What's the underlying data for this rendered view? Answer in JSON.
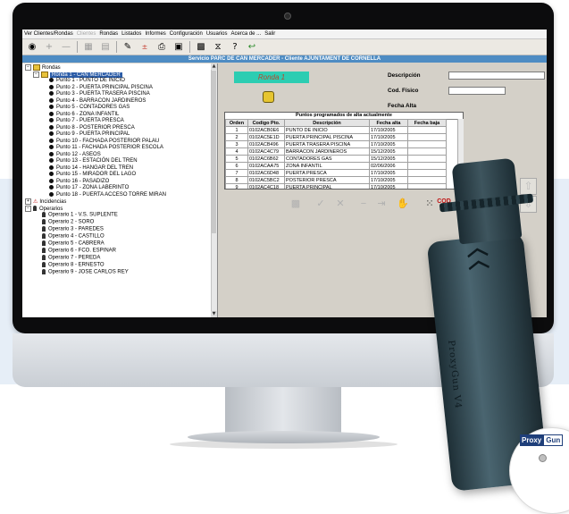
{
  "menu": [
    "Ver Clientes/Rondas",
    "Clientes",
    "Rondas",
    "Listados",
    "Informes",
    "Configuración",
    "Usuarios",
    "Acerca de ...",
    "Salir"
  ],
  "title": "Servicio PARC DE CAN MERCADER - Cliente AJUNTAMENT DE CORNELLA",
  "tree": {
    "root": "Rondas",
    "ronda": "Ronda 1 - CAN MERCADER",
    "puntos": [
      "Punto 1 - PUNTO DE INICIO",
      "Punto 2 - PUERTA PRINCIPAL PISCINA",
      "Punto 3 - PUERTA TRASERA PISCINA",
      "Punto 4 - BARRACON JARDINEROS",
      "Punto 5 - CONTADORES GAS",
      "Punto 6 - ZONA INFANTIL",
      "Punto 7 - PUERTA PRESCA",
      "Punto 8 - POSTERIOR PRESCA",
      "Punto 9 - PUERTA PRINCIPAL",
      "Punto 10 - FACHADA POSTERIOR PALAU",
      "Punto 11 - FACHADA POSTERIOR ESCOLA",
      "Punto 12 - ASEOS",
      "Punto 13 - ESTACIÓN DEL TREN",
      "Punto 14 - HANGAR DEL TREN",
      "Punto 15 - MIRADOR DEL LAGO",
      "Punto 16 - PASADIZO",
      "Punto 17 - ZONA LABERINTO",
      "Punto 18 - PUERTA ACCESO TORRE MIRAN"
    ],
    "incidencias": "Incidencias",
    "operarios_label": "Operarios",
    "operarios": [
      "Operario 1 - V.S. SUPLENTE",
      "Operario 2 - SORO",
      "Operario 3 - PAREDES",
      "Operario 4 - CASTILLO",
      "Operario 5 - CABRERA",
      "Operario 6 - FCO. ESPINAR",
      "Operario 7 - PEREDA",
      "Operario 8 - ERNESTO",
      "Operario 9 - JOSE CARLOS REY"
    ]
  },
  "panel": {
    "ronda_title": "Ronda 1",
    "descripcion_label": "Descripción",
    "codfisico_label": "Cod. Físico",
    "fecha_alta_label": "Fecha Alta"
  },
  "grid": {
    "caption": "Puntos programados de alta actualmente",
    "headers": [
      "Orden",
      "Codigo Pto.",
      "Descripción",
      "Fecha alta",
      "Fecha baja"
    ],
    "rows": [
      [
        "1",
        "0102ACB0E6",
        "PUNTO DE INICIO",
        "17/10/2005",
        ""
      ],
      [
        "2",
        "0102AC5E1D",
        "PUERTA PRINCIPAL PISCINA",
        "17/10/2005",
        ""
      ],
      [
        "3",
        "0102ACB496",
        "PUERTA TRASERA PISCINA",
        "17/10/2005",
        ""
      ],
      [
        "4",
        "0102AC4C79",
        "BARRACON JARDINEROS",
        "15/12/2005",
        ""
      ],
      [
        "5",
        "0102AC6B62",
        "CONTADORES GAS",
        "15/12/2005",
        ""
      ],
      [
        "6",
        "0102ACAA75",
        "ZONA INFANTIL",
        "02/06/2006",
        ""
      ],
      [
        "7",
        "0102AC6D48",
        "PUERTA PRESCA",
        "17/10/2005",
        ""
      ],
      [
        "8",
        "0102AC5BC2",
        "POSTERIOR PRESCA",
        "17/10/2005",
        ""
      ],
      [
        "9",
        "0102AC4C18",
        "PUERTA PRINCIPAL",
        "17/10/2005",
        ""
      ],
      [
        "10",
        "0102AC6348",
        "FACHADA POSTERIOR PALAU",
        "17/10/2005",
        ""
      ],
      [
        "11",
        "0102ACB578",
        "FACHADA POSTERIOR ESCOLA",
        "17/10/2005",
        ""
      ],
      [
        "12",
        "0102AC6E8C",
        "ASEOS",
        "17/10/2005",
        ""
      ],
      [
        "13",
        "0102AC5C7A",
        "ESTACIÓN DEL TREN",
        "17/10/2005",
        ""
      ]
    ]
  },
  "device": {
    "label": "ProxyGun V4"
  },
  "badge": {
    "brand_a": "Proxy",
    "brand_b": "Gun"
  },
  "icons": [
    "eye-icon",
    "plus-icon",
    "minus-icon",
    "grid-icon",
    "pen-icon",
    "plus-minus-icon",
    "printer-icon",
    "calculator-icon",
    "filter-icon",
    "help-icon",
    "back-icon"
  ],
  "colors": {
    "titlebar": "#4e8cc3",
    "selection": "#2c5da8",
    "ronda_box": "#2ccdb2",
    "ronda_text": "#b8472d"
  }
}
